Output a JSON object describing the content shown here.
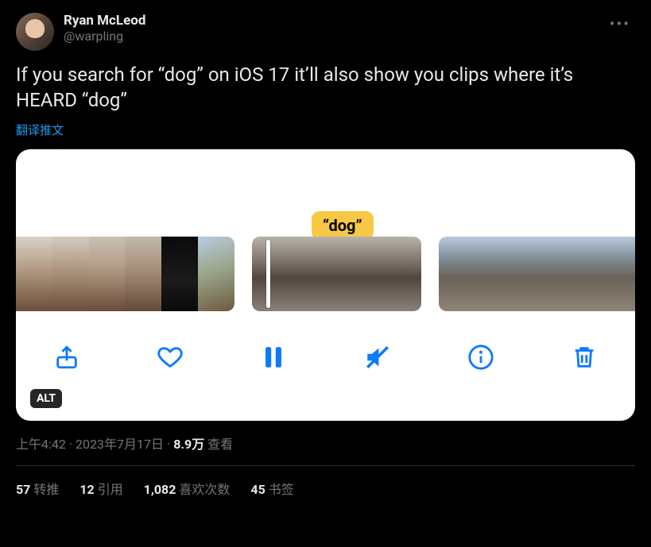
{
  "author": {
    "display_name": "Ryan McLeod",
    "handle": "@warpling"
  },
  "tweet_text": "If you search for “dog” on iOS 17 it’ll also show you clips where it’s HEARD “dog”",
  "translate_label": "翻译推文",
  "media": {
    "search_token": "“dog”",
    "alt_badge": "ALT",
    "toolbar": {
      "share": "share",
      "like": "like",
      "pause": "pause",
      "mute": "mute",
      "info": "info",
      "delete": "delete"
    }
  },
  "meta": {
    "time": "上午4:42",
    "date": "2023年7月17日",
    "views_count": "8.9万",
    "views_label": "查看"
  },
  "stats": {
    "retweets": {
      "count": "57",
      "label": "转推"
    },
    "quotes": {
      "count": "12",
      "label": "引用"
    },
    "likes": {
      "count": "1,082",
      "label": "喜欢次数"
    },
    "bookmarks": {
      "count": "45",
      "label": "书签"
    }
  }
}
